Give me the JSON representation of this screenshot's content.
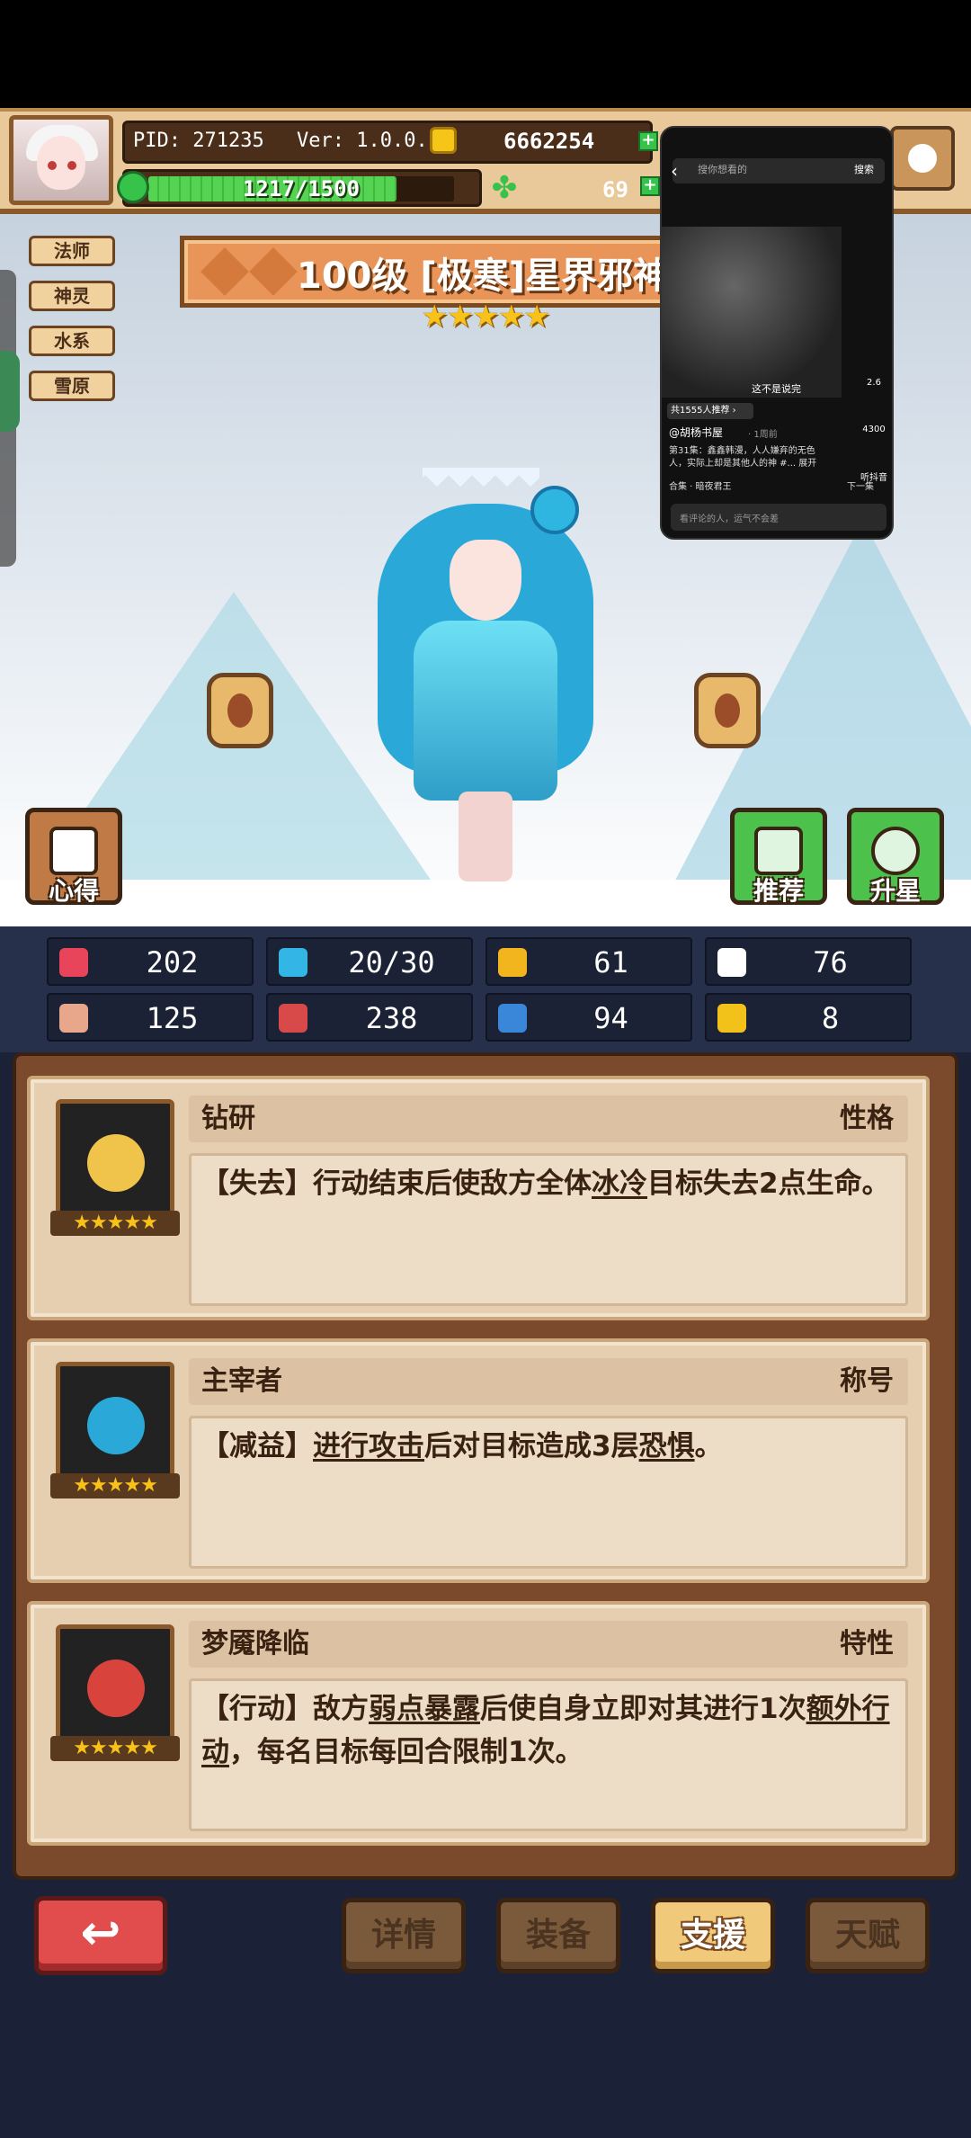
{
  "header": {
    "pid": "PID: 271235",
    "version": "Ver: 1.0.0.10",
    "coins": "6662254",
    "xp_text": "1217/1500",
    "xp_progress": 0.811,
    "gems": "69",
    "plus_symbol": "+"
  },
  "tags": [
    "法师",
    "神灵",
    "水系",
    "雪原"
  ],
  "character": {
    "title": "100级  [极寒]星界邪神",
    "star_rating": 5,
    "stars_display": "★★★★★"
  },
  "scene_buttons": {
    "notes": "心得",
    "recommend": "推荐",
    "star_up": "升星"
  },
  "overlay": {
    "back_symbol": "‹",
    "search_placeholder": "搜你想看的",
    "search_button": "搜索",
    "caption_main": "这不是说完",
    "badge": "共1555人推荐 ›",
    "user": "@胡杨书屋",
    "time": "· 1周前",
    "desc_line1": "第31集：鑫鑫韩漫，人人嫌弃的无色",
    "desc_line2": "人，实际上却是其他人的神 #... 展开",
    "collection": "合集 · 暗夜君王",
    "next": "下一集",
    "comment_placeholder": "看评论的人，运气不会差",
    "side_counts": [
      "2.6",
      "4300",
      "听抖音"
    ]
  },
  "stats": [
    {
      "icon": "heart-icon",
      "value": "202",
      "color": "#e8445a"
    },
    {
      "icon": "water-drop-icon",
      "value": "20/30",
      "color": "#33b6e6"
    },
    {
      "icon": "shield-icon",
      "value": "61",
      "color": "#f2b51e"
    },
    {
      "icon": "wing-icon",
      "value": "76",
      "color": "#ffffff"
    },
    {
      "icon": "fist-icon",
      "value": "125",
      "color": "#e8a78a"
    },
    {
      "icon": "spellbook-icon",
      "value": "238",
      "color": "#d84a4a"
    },
    {
      "icon": "scroll-icon",
      "value": "94",
      "color": "#3a86d8"
    },
    {
      "icon": "horseshoe-icon",
      "value": "8",
      "color": "#f2c21b"
    }
  ],
  "cards": [
    {
      "name": "钻研",
      "kind": "性格",
      "stars": "★★★★★",
      "desc_parts": [
        "【失去】行动结束后使敌方全体",
        "冰冷",
        "目标失去2点生命。"
      ]
    },
    {
      "name": "主宰者",
      "kind": "称号",
      "stars": "★★★★★",
      "desc_parts": [
        "【减益】",
        "进行攻击",
        "后对目标造成3层",
        "恐惧",
        "。"
      ]
    },
    {
      "name": "梦魇降临",
      "kind": "特性",
      "stars": "★★★★★",
      "desc_parts": [
        "【行动】敌方",
        "弱点暴露",
        "后使自身立即对其进行1次",
        "额外行动",
        "，每名目标每回合限制1次。"
      ]
    }
  ],
  "bottom_nav": {
    "back_symbol": "↩",
    "details": "详情",
    "equipment": "装备",
    "support": "支援",
    "talent": "天赋"
  }
}
